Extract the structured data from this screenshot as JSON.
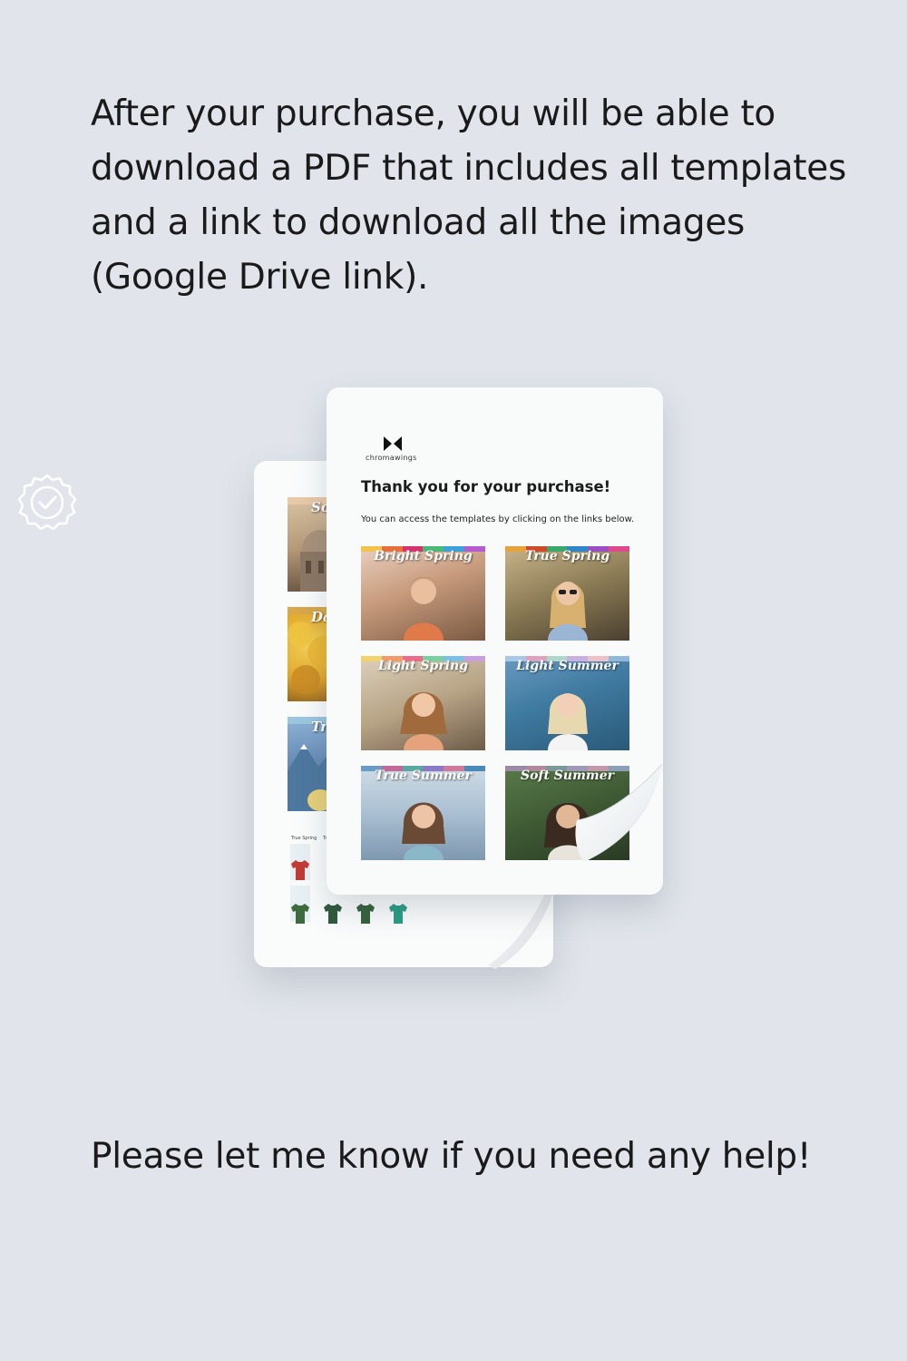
{
  "intro_text": "After your purchase, you will be able to download a PDF that includes all templates and a link to download all the images (Google Drive link).",
  "outro_text": "Please let me know if you need any help!",
  "badge_icon": "verified-badge-icon",
  "front_page": {
    "brand": "chromawings",
    "title": "Thank you for your purchase!",
    "subtitle": "You can access the templates by clicking on the links below.",
    "templates": [
      {
        "label": "Bright Spring"
      },
      {
        "label": "True Spring"
      },
      {
        "label": "Light Spring"
      },
      {
        "label": "Light Summer"
      },
      {
        "label": "True Summer"
      },
      {
        "label": "Soft Summer"
      }
    ]
  },
  "back_page": {
    "thumb_labels": [
      "So",
      "Da",
      "Tr"
    ],
    "shirt_labels": [
      "True Spring",
      "Tr"
    ]
  }
}
